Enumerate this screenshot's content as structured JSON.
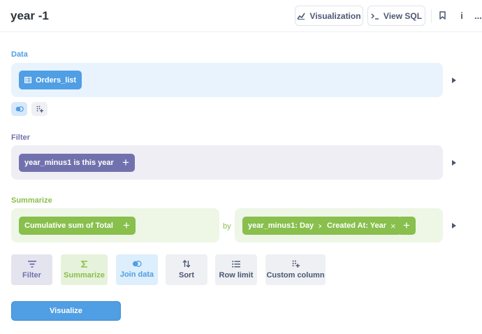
{
  "header": {
    "title": "year -1",
    "visualization_label": "Visualization",
    "view_sql_label": "View SQL",
    "info_label": "i",
    "more_label": "..."
  },
  "data_section": {
    "label": "Data",
    "table_name": "Orders_list"
  },
  "filter_section": {
    "label": "Filter",
    "filters": [
      "year_minus1 is this year"
    ],
    "remove_glyph": "×",
    "add_glyph": "+"
  },
  "summarize_section": {
    "label": "Summarize",
    "metrics": [
      "Cumulative sum of Total"
    ],
    "by_label": "by",
    "breakouts": [
      "year_minus1: Day",
      "Created At: Year"
    ],
    "remove_glyph": "×",
    "add_glyph": "+"
  },
  "actions": [
    {
      "label": "Filter",
      "icon": "filter-icon"
    },
    {
      "label": "Summarize",
      "icon": "sigma-icon"
    },
    {
      "label": "Join data",
      "icon": "join-icon"
    },
    {
      "label": "Sort",
      "icon": "sort-icon"
    },
    {
      "label": "Row limit",
      "icon": "list-icon"
    },
    {
      "label": "Custom column",
      "icon": "custom-column-icon"
    }
  ],
  "visualize_label": "Visualize",
  "colors": {
    "brand": "#509ee3",
    "filter": "#7172ad",
    "summarize": "#88bf4d",
    "data_panel": "#e8f3fd",
    "filter_panel": "#eeeef4",
    "summarize_panel": "#eef6e6"
  }
}
